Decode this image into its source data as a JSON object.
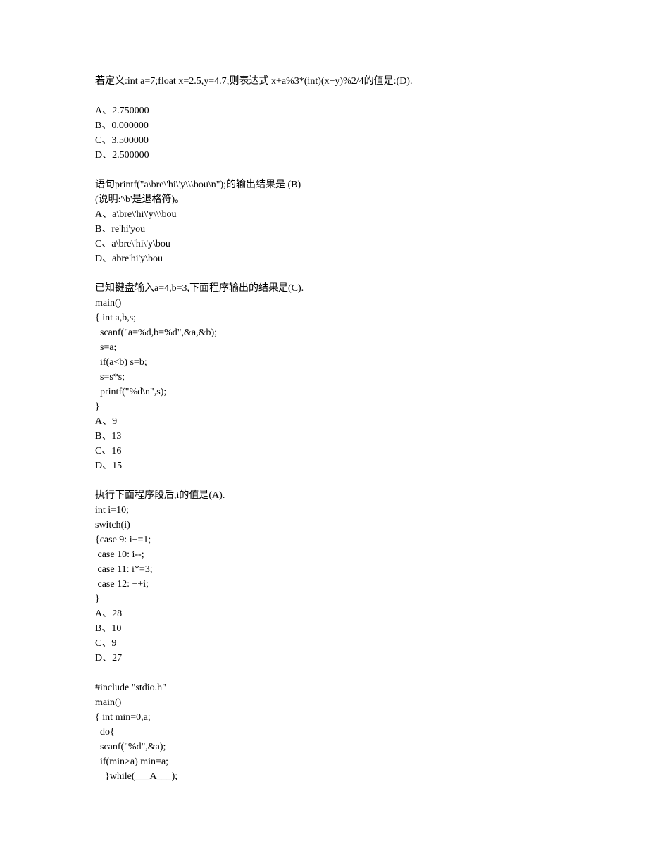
{
  "q1": {
    "question": "若定义:int a=7;float x=2.5,y=4.7;则表达式 x+a%3*(int)(x+y)%2/4的值是:(D).",
    "opts": [
      "A、2.750000",
      "B、0.000000",
      "C、3.500000",
      "D、2.500000"
    ]
  },
  "q2": {
    "question": "语句printf(\"a\\bre\\'hi\\'y\\\\\\bou\\n\");的输出结果是 (B)",
    "note": "(说明:'\\b'是退格符)。",
    "opts": [
      "A、a\\bre\\'hi\\'y\\\\\\bou",
      "B、re'hi'you",
      "C、a\\bre\\'hi\\'y\\bou",
      "D、abre'hi'y\\bou"
    ]
  },
  "q3": {
    "question": "已知键盘输入a=4,b=3,下面程序输出的结果是(C).",
    "code": [
      "main()",
      "{ int a,b,s;",
      "  scanf(\"a=%d,b=%d\",&a,&b);",
      "  s=a;",
      "  if(a<b) s=b;",
      "  s=s*s;",
      "  printf(\"%d\\n\",s);",
      "}"
    ],
    "opts": [
      "A、9",
      "B、13",
      "C、16",
      "D、15"
    ]
  },
  "q4": {
    "question": "执行下面程序段后,i的值是(A).",
    "code": [
      "int i=10;",
      "switch(i)",
      "{case 9: i+=1;",
      " case 10: i--;",
      " case 11: i*=3;",
      " case 12: ++i;",
      "}"
    ],
    "opts": [
      "A、28",
      "B、10",
      "C、9",
      "D、27"
    ]
  },
  "q5": {
    "code": [
      "#include \"stdio.h\"",
      "main()",
      "{ int min=0,a;",
      "  do{",
      "  scanf(\"%d\",&a);",
      "  if(min>a) min=a;",
      "    }while(___A___);"
    ]
  }
}
